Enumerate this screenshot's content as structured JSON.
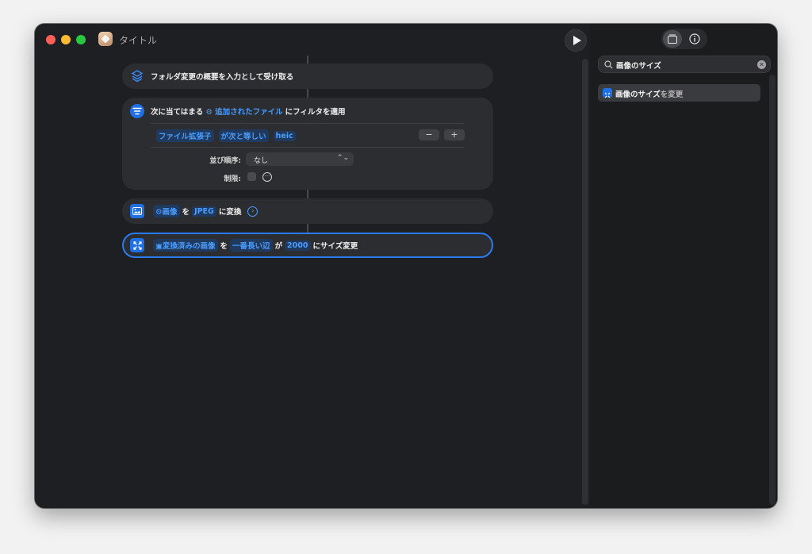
{
  "window": {
    "title": "タイトル"
  },
  "actions": {
    "folder": {
      "text": "フォルダ変更の概要を入力として受け取る"
    },
    "filter": {
      "prefix": "次に当てはまる",
      "input_token": "追加されたファイル",
      "suffix": "にフィルタを適用",
      "condition": {
        "field": "ファイル拡張子",
        "operator": "が次と等しい",
        "value": "heic"
      },
      "remove_label": "−",
      "add_label": "+",
      "sort_label": "並び順序:",
      "sort_value": "なし",
      "limit_label": "制限:"
    },
    "convert": {
      "input_token": "画像",
      "particle": "を",
      "format_token": "JPEG",
      "suffix": "に変換"
    },
    "resize": {
      "input_token": "変換済みの画像",
      "particle_wo": "を",
      "edge_token": "一番長い辺",
      "particle_ga": "が",
      "size_token": "2000",
      "suffix": "にサイズ変更"
    }
  },
  "sidebar": {
    "search_value": "画像のサイズ",
    "results": [
      {
        "highlight": "画像のサイズ",
        "rest": "を変更"
      }
    ]
  },
  "colors": {
    "accent": "#1f6fe5",
    "token_text": "#4a9dff",
    "card": "#2c2d30",
    "window": "#1e1f22"
  }
}
